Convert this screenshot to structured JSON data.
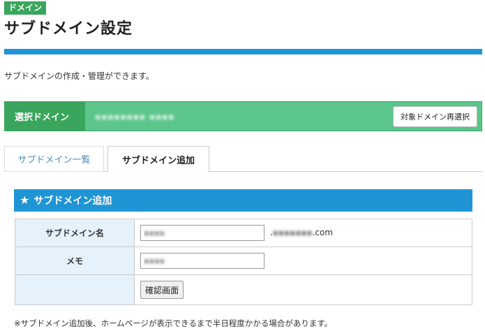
{
  "header": {
    "category_badge": "ドメイン",
    "title": "サブドメイン設定",
    "description": "サブドメインの作成・管理ができます。"
  },
  "domain_bar": {
    "label": "選択ドメイン",
    "value": "▪▪▪▪▪▪▪▪ ▪▪▪▪",
    "reselect_label": "対象ドメイン再選択"
  },
  "tabs": [
    {
      "label": "サブドメイン一覧",
      "active": false
    },
    {
      "label": "サブドメイン追加",
      "active": true
    }
  ],
  "section": {
    "icon": "star-icon",
    "title": "サブドメイン追加"
  },
  "form": {
    "subdomain_label": "サブドメイン名",
    "subdomain_value": "▪▪▪▪",
    "domain_suffix_blur": "▪▪▪▪▪▪▪",
    "domain_suffix_tld": ".com",
    "memo_label": "メモ",
    "memo_value": "▪▪▪▪",
    "confirm_label": "確認画面"
  },
  "footnote": "※サブドメイン追加後、ホームページが表示できるまで半日程度かかる場合があります。",
  "colors": {
    "accent_blue": "#1f95d6",
    "accent_green": "#3aa55c",
    "bar_green": "#5bc58b",
    "label_bg": "#e5f1fb"
  }
}
